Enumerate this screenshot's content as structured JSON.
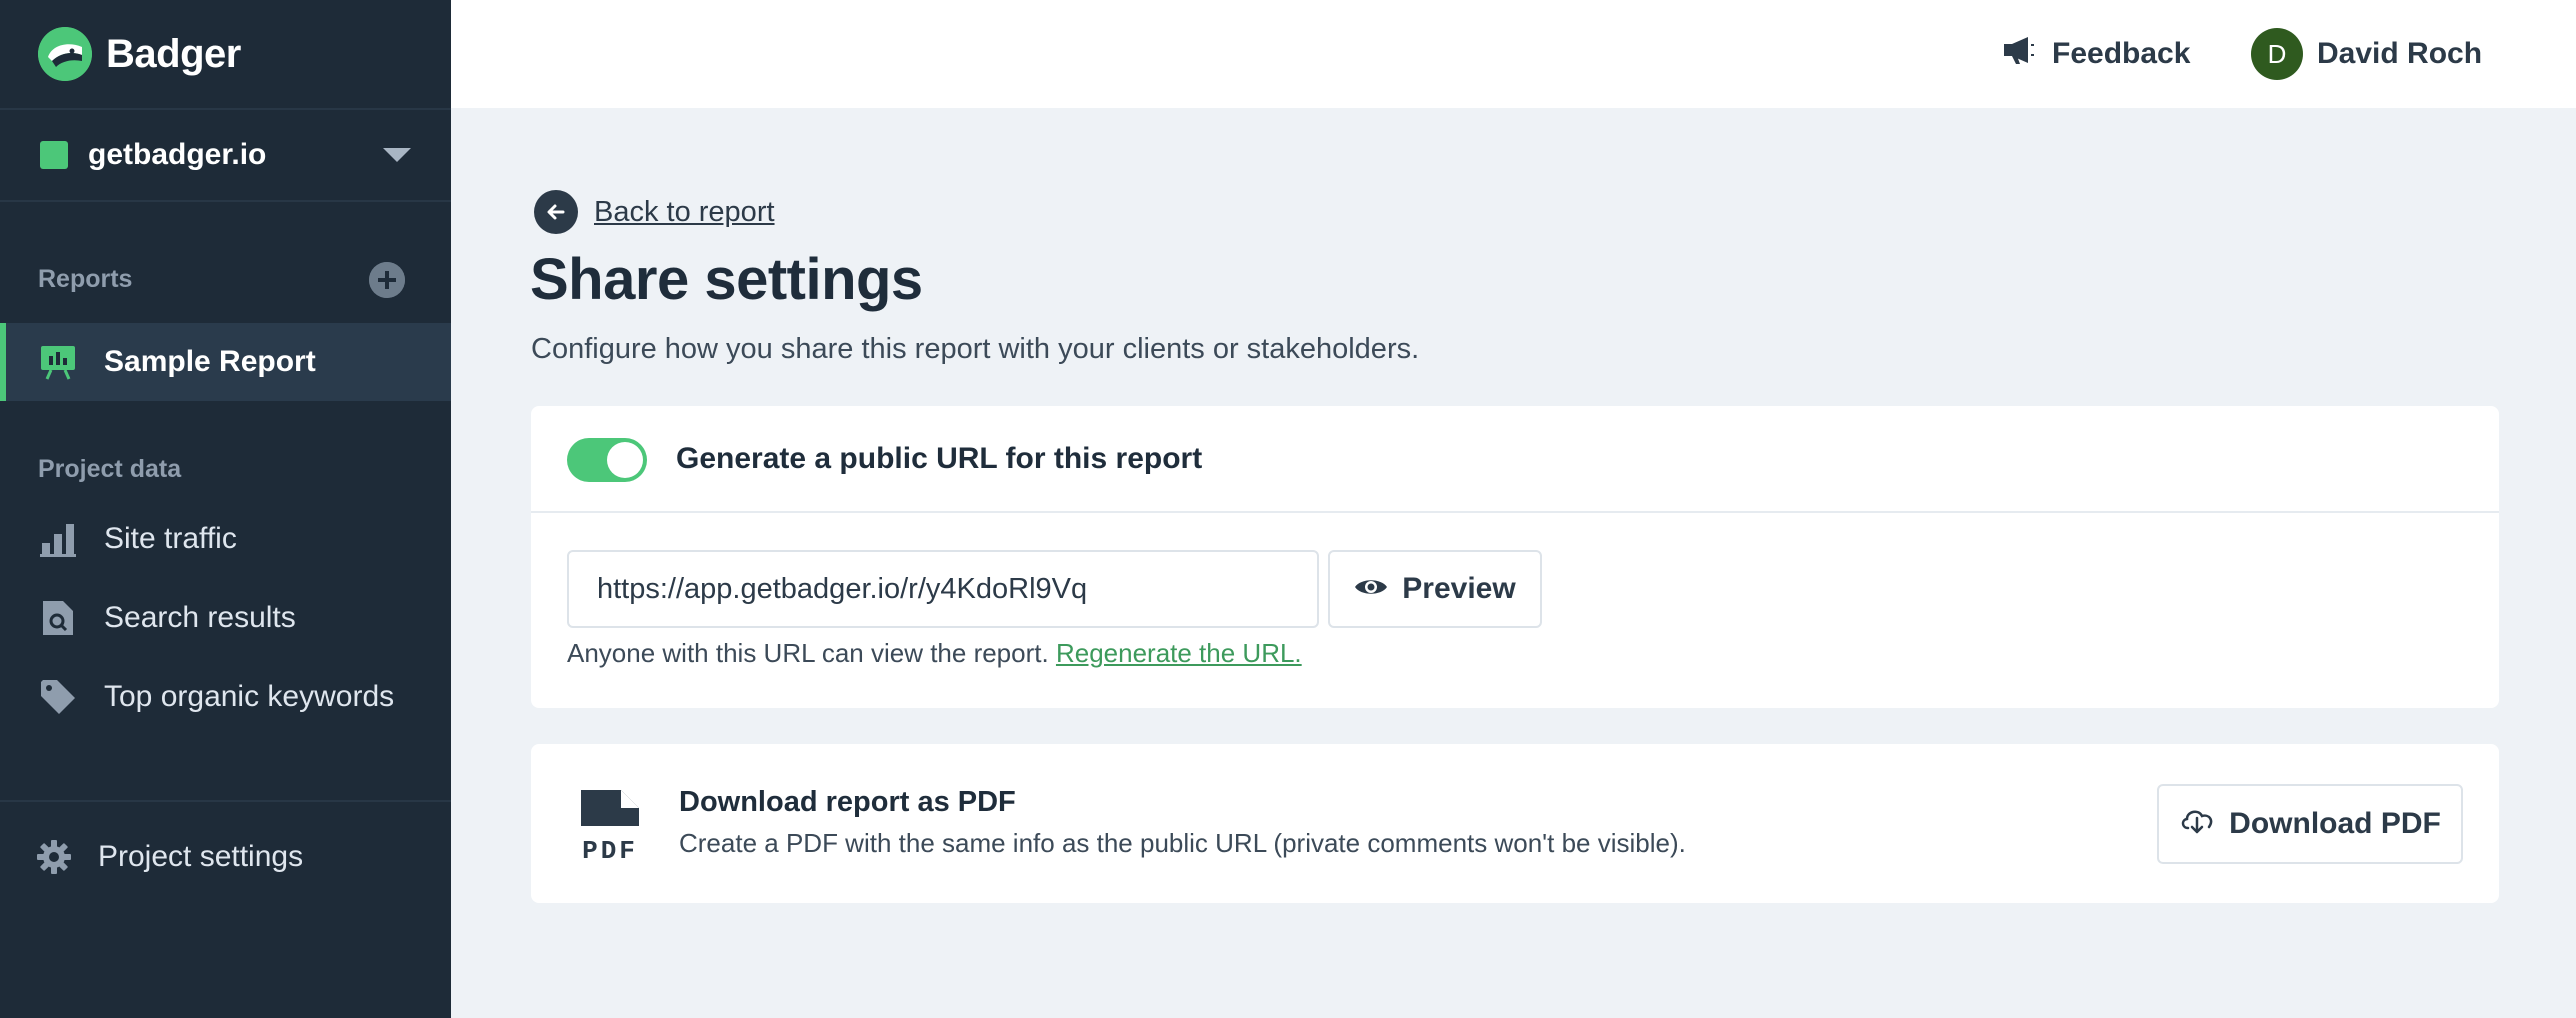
{
  "brand": {
    "name": "Badger",
    "logo_icon": "badger-logo-icon",
    "accent": "#4cc779"
  },
  "project": {
    "name": "getbadger.io",
    "color": "#4cc779"
  },
  "sidebar": {
    "reports_title": "Reports",
    "reports": [
      {
        "label": "Sample Report",
        "icon": "presentation-chart-icon",
        "active": true
      }
    ],
    "project_data_title": "Project data",
    "project_data": [
      {
        "label": "Site traffic",
        "icon": "bar-chart-icon"
      },
      {
        "label": "Search results",
        "icon": "search-document-icon"
      },
      {
        "label": "Top organic keywords",
        "icon": "tag-icon"
      }
    ],
    "settings_label": "Project settings"
  },
  "topbar": {
    "feedback_label": "Feedback",
    "user": {
      "initial": "D",
      "name": "David Roch"
    }
  },
  "main": {
    "back_label": "Back to report",
    "title": "Share settings",
    "subtitle": "Configure how you share this report with your clients or stakeholders.",
    "public_url": {
      "toggle_on": true,
      "toggle_label": "Generate a public URL for this report",
      "url_value": "https://app.getbadger.io/r/y4KdoRl9Vq",
      "preview_label": "Preview",
      "help_text": "Anyone with this URL can view the report.",
      "regenerate_label": "Regenerate the URL."
    },
    "pdf": {
      "title": "Download report as PDF",
      "description": "Create a PDF with the same info as the public URL (private comments won't be visible).",
      "button_label": "Download PDF",
      "icon_text": "PDF"
    }
  }
}
